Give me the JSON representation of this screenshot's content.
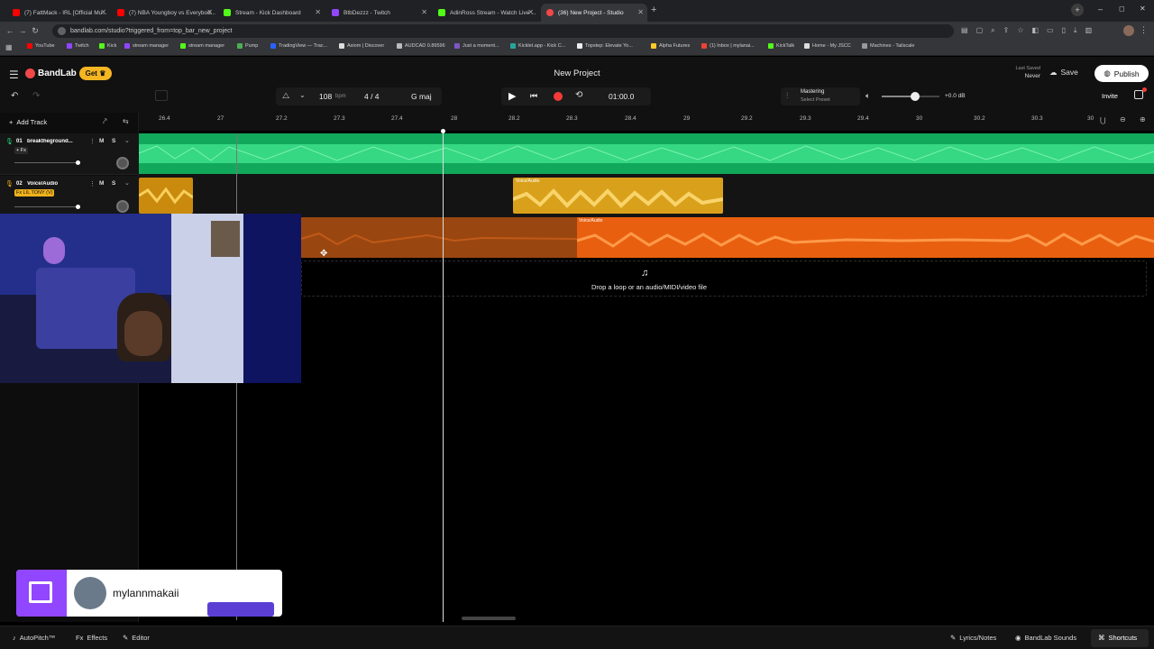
{
  "browser": {
    "tabs": [
      {
        "label": "(7) FattMack - IRL [Official Mu...",
        "color": "#ff0000"
      },
      {
        "label": "(7) NBA Youngboy vs Everybod...",
        "color": "#ff0000"
      },
      {
        "label": "Stream - Kick Dashboard",
        "color": "#53fc18"
      },
      {
        "label": "BtbDezzz - Twitch",
        "color": "#9146ff"
      },
      {
        "label": "AdinRoss Stream - Watch Live ...",
        "color": "#53fc18"
      },
      {
        "label": "(36) New Project - Studio",
        "color": "#f24848"
      }
    ],
    "url": "bandlab.com/studio?triggered_from=top_bar_new_project",
    "bookmarks": [
      "YouTube",
      "Twitch",
      "Kick",
      "stream manager",
      "stream manager",
      "Pump",
      "TradingView — Trac...",
      "Axiom | Discover",
      "AUDCAD 0.89596",
      "Just a moment...",
      "Kicklet.app - Kick C...",
      "Topstep: Elevate Yo...",
      "Alpha Futures",
      "(1) Inbox | mylanai...",
      "KickTalk",
      "Home - My JSCC",
      "Machines - Tailscale"
    ]
  },
  "header": {
    "brand": "BandLab",
    "get_label": "Get",
    "project_title": "New Project",
    "last_saved_label": "Last Saved",
    "last_saved_value": "Never",
    "save_label": "Save",
    "publish_label": "Publish",
    "invite_label": "Invite"
  },
  "transport": {
    "bpm": "108",
    "bpm_unit": "bpm",
    "time_sig": "4 / 4",
    "key": "G maj",
    "time": "01:00.0",
    "mastering_label": "Mastering",
    "mastering_preset": "Select Preset",
    "volume_db": "+0.0 dB",
    "volume_level": 0.58
  },
  "toolbar": {
    "add_track_label": "Add Track"
  },
  "ruler": [
    "26.4",
    "27",
    "27.2",
    "27.3",
    "27.4",
    "28",
    "28.2",
    "28.3",
    "28.4",
    "29",
    "29.2",
    "29.3",
    "29.4",
    "30",
    "30.2",
    "30.3",
    "30"
  ],
  "tracks": [
    {
      "num": "01",
      "name": "breaktheground...",
      "fx": "+ Fx",
      "mute": "M",
      "solo": "S",
      "color": "#22d67a"
    },
    {
      "num": "02",
      "name": "Voice/Audio",
      "fx": "Fx LIL TONY (V)",
      "mute": "M",
      "solo": "S",
      "color": "#f0b21c"
    }
  ],
  "clips": {
    "voice_clip_label": "Voice/Audio",
    "orange_clip_label": "Voice/Audio"
  },
  "drop_zone_text": "Drop a loop or an audio/MIDI/video file",
  "overlay": {
    "username": "mylannmakaii"
  },
  "bottom": {
    "autopitch": "AutoPitch™",
    "effects": "Effects",
    "editor": "Editor",
    "lyrics": "Lyrics/Notes",
    "sounds": "BandLab Sounds",
    "shortcuts": "Shortcuts"
  },
  "colors": {
    "green_track": "#22d67a",
    "yellow_track": "#f0b21c",
    "orange_clip": "#e8600f",
    "record": "#f23a3a",
    "twitch": "#9146ff"
  }
}
